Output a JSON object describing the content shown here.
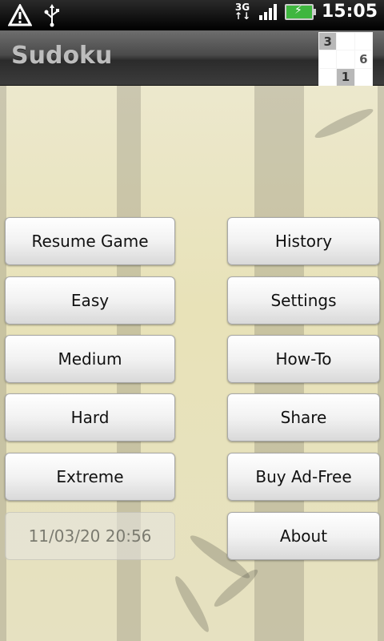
{
  "status_bar": {
    "network": "3G",
    "time": "15:05",
    "icons": [
      "warning-icon",
      "usb-icon",
      "network-3g-icon",
      "signal-icon",
      "battery-charging-icon"
    ]
  },
  "app": {
    "title": "Sudoku",
    "logo_cells": [
      "3",
      "",
      "",
      "",
      "",
      "6",
      "",
      "1",
      ""
    ]
  },
  "menu": {
    "left": [
      "Resume Game",
      "Easy",
      "Medium",
      "Hard",
      "Extreme"
    ],
    "saved_game_timestamp": "11/03/20 20:56",
    "right": [
      "History",
      "Settings",
      "How-To",
      "Share",
      "Buy Ad-Free",
      "About"
    ]
  }
}
